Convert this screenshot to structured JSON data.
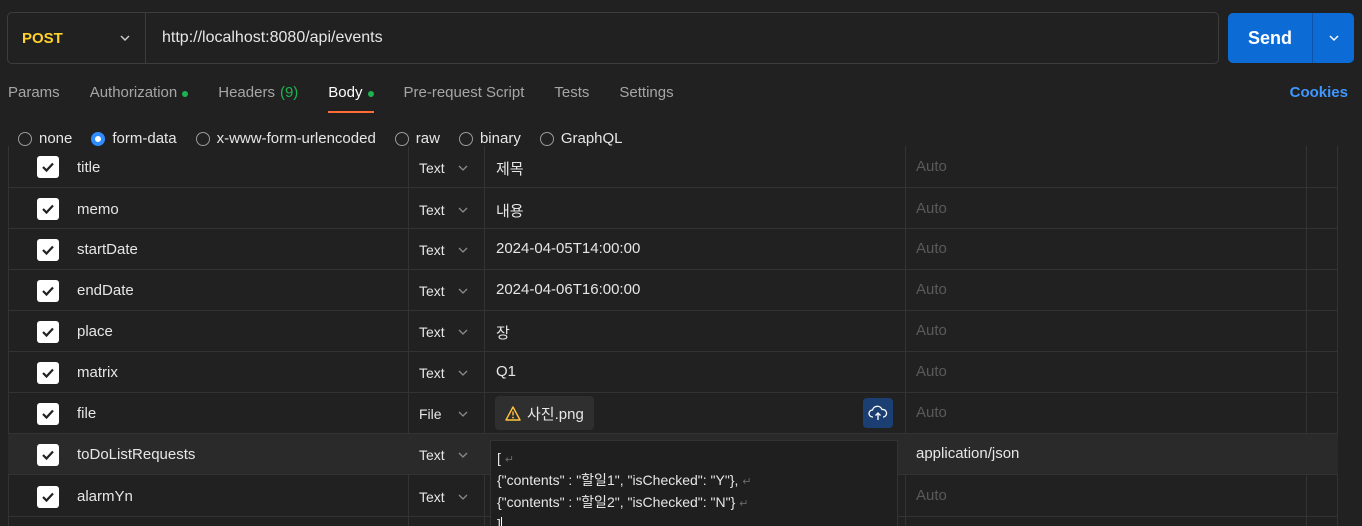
{
  "request": {
    "method": "POST",
    "url": "http://localhost:8080/api/events",
    "send_label": "Send"
  },
  "tabs": [
    {
      "label": "Params"
    },
    {
      "label": "Authorization",
      "dot": true
    },
    {
      "label": "Headers",
      "count": "(9)"
    },
    {
      "label": "Body",
      "dot": true,
      "active": true
    },
    {
      "label": "Pre-request Script"
    },
    {
      "label": "Tests"
    },
    {
      "label": "Settings"
    }
  ],
  "cookies_label": "Cookies",
  "body_types": [
    {
      "label": "none",
      "selected": false
    },
    {
      "label": "form-data",
      "selected": true
    },
    {
      "label": "x-www-form-urlencoded",
      "selected": false
    },
    {
      "label": "raw",
      "selected": false
    },
    {
      "label": "binary",
      "selected": false
    },
    {
      "label": "GraphQL",
      "selected": false
    }
  ],
  "form_rows": [
    {
      "key": "title",
      "type": "Text",
      "value": "제목",
      "content_type": "Auto"
    },
    {
      "key": "memo",
      "type": "Text",
      "value": "내용",
      "content_type": "Auto"
    },
    {
      "key": "startDate",
      "type": "Text",
      "value": "2024-04-05T14:00:00",
      "content_type": "Auto"
    },
    {
      "key": "endDate",
      "type": "Text",
      "value": "2024-04-06T16:00:00",
      "content_type": "Auto"
    },
    {
      "key": "place",
      "type": "Text",
      "value": "장",
      "content_type": "Auto"
    },
    {
      "key": "matrix",
      "type": "Text",
      "value": "Q1",
      "content_type": "Auto"
    },
    {
      "key": "file",
      "type": "File",
      "value": "사진.png",
      "content_type": "Auto"
    },
    {
      "key": "toDoListRequests",
      "type": "Text",
      "value": "",
      "content_type": "application/json"
    },
    {
      "key": "alarmYn",
      "type": "Text",
      "value": "",
      "content_type": "Auto"
    }
  ],
  "json_lines": [
    "[",
    "{\"contents\" : \"할일1\", \"isChecked\": \"Y\"},",
    "{\"contents\" : \"할일2\", \"isChecked\": \"N\"}",
    "]"
  ],
  "newline_marker": "↵",
  "colors": {
    "method": "#ffd12d",
    "send": "#0d6bd6",
    "accent": "#ff6c37",
    "dot": "#1db34f",
    "link": "#3f97ff"
  }
}
